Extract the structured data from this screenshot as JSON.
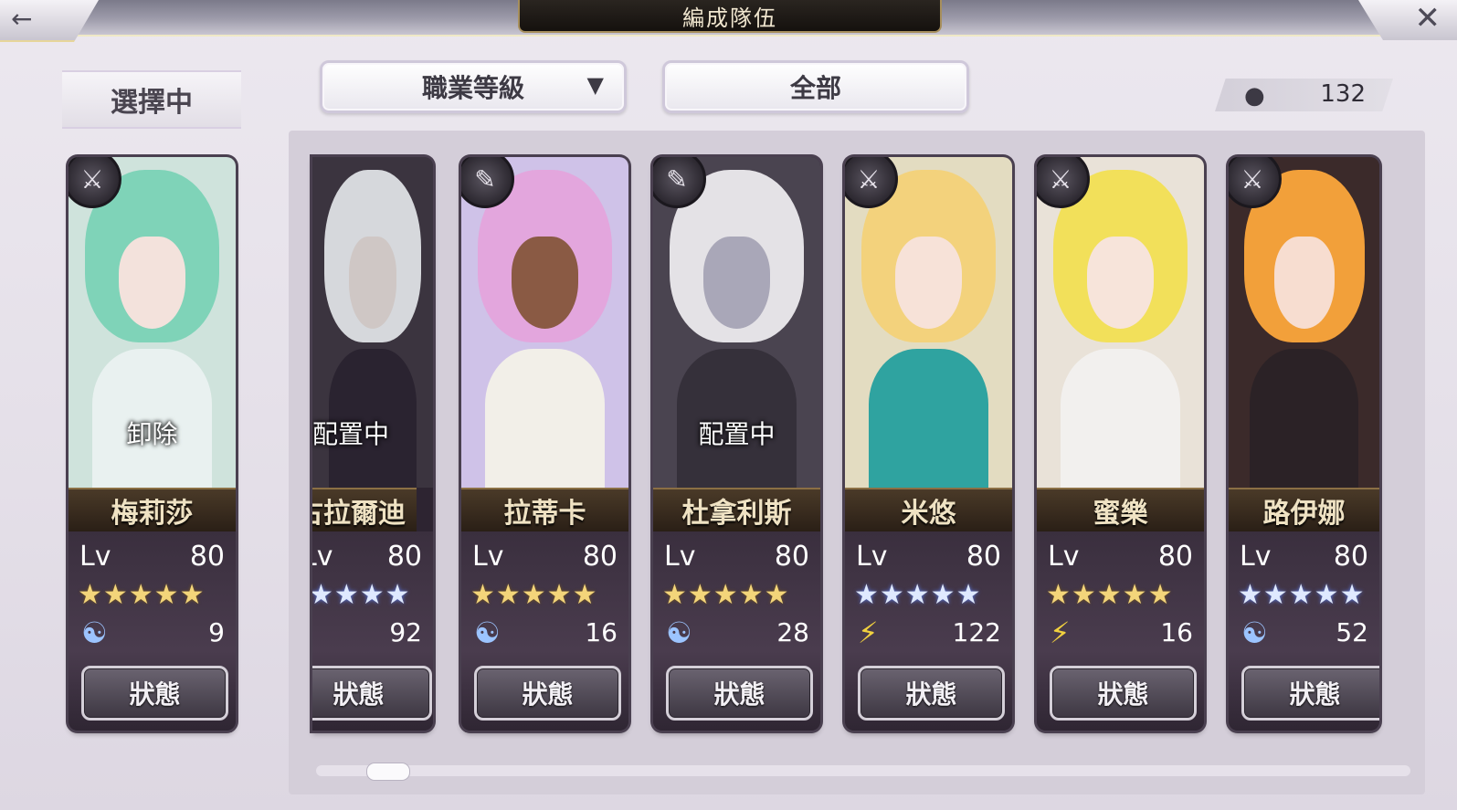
{
  "header": {
    "title": "編成隊伍",
    "back_icon": "←",
    "close_icon": "✕"
  },
  "selected": {
    "label": "選擇中"
  },
  "filters": {
    "sort_label": "職業等級",
    "sort_caret": "▼",
    "filter_label": "全部"
  },
  "count": {
    "icon": "person-icon",
    "value": "132"
  },
  "cards": [
    {
      "name": "梅莉莎",
      "overlay": "卸除",
      "lv_label": "Lv",
      "level": "80",
      "stars": "★★★★★",
      "star_color": "gold",
      "element": "wind",
      "element_glyph": "☯",
      "element_value": "9",
      "status": "狀態",
      "class_glyph": "⚔"
    },
    {
      "name": "古拉爾迪",
      "overlay": "配置中",
      "lv_label": "Lv",
      "level": "80",
      "stars": "★★★★",
      "star_color": "blue",
      "element": "wind",
      "element_glyph": "☯",
      "element_value": "92",
      "status": "狀態",
      "class_glyph": "⚔"
    },
    {
      "name": "拉蒂卡",
      "overlay": "",
      "lv_label": "Lv",
      "level": "80",
      "stars": "★★★★★",
      "star_color": "gold",
      "element": "wind",
      "element_glyph": "☯",
      "element_value": "16",
      "status": "狀態",
      "class_glyph": "✎"
    },
    {
      "name": "杜拿利斯",
      "overlay": "配置中",
      "lv_label": "Lv",
      "level": "80",
      "stars": "★★★★★",
      "star_color": "gold",
      "element": "wind",
      "element_glyph": "☯",
      "element_value": "28",
      "status": "狀態",
      "class_glyph": "✎"
    },
    {
      "name": "米悠",
      "overlay": "",
      "lv_label": "Lv",
      "level": "80",
      "stars": "★★★★★",
      "star_color": "blue",
      "element": "thunder",
      "element_glyph": "⚡",
      "element_value": "122",
      "status": "狀態",
      "class_glyph": "⚔"
    },
    {
      "name": "蜜樂",
      "overlay": "",
      "lv_label": "Lv",
      "level": "80",
      "stars": "★★★★★",
      "star_color": "gold",
      "element": "thunder",
      "element_glyph": "⚡",
      "element_value": "16",
      "status": "狀態",
      "class_glyph": "⚔"
    },
    {
      "name": "路伊娜",
      "overlay": "",
      "lv_label": "Lv",
      "level": "80",
      "stars": "★★★★★",
      "star_color": "blue",
      "element": "wind",
      "element_glyph": "☯",
      "element_value": "52",
      "status": "狀態",
      "class_glyph": "⚔"
    }
  ]
}
